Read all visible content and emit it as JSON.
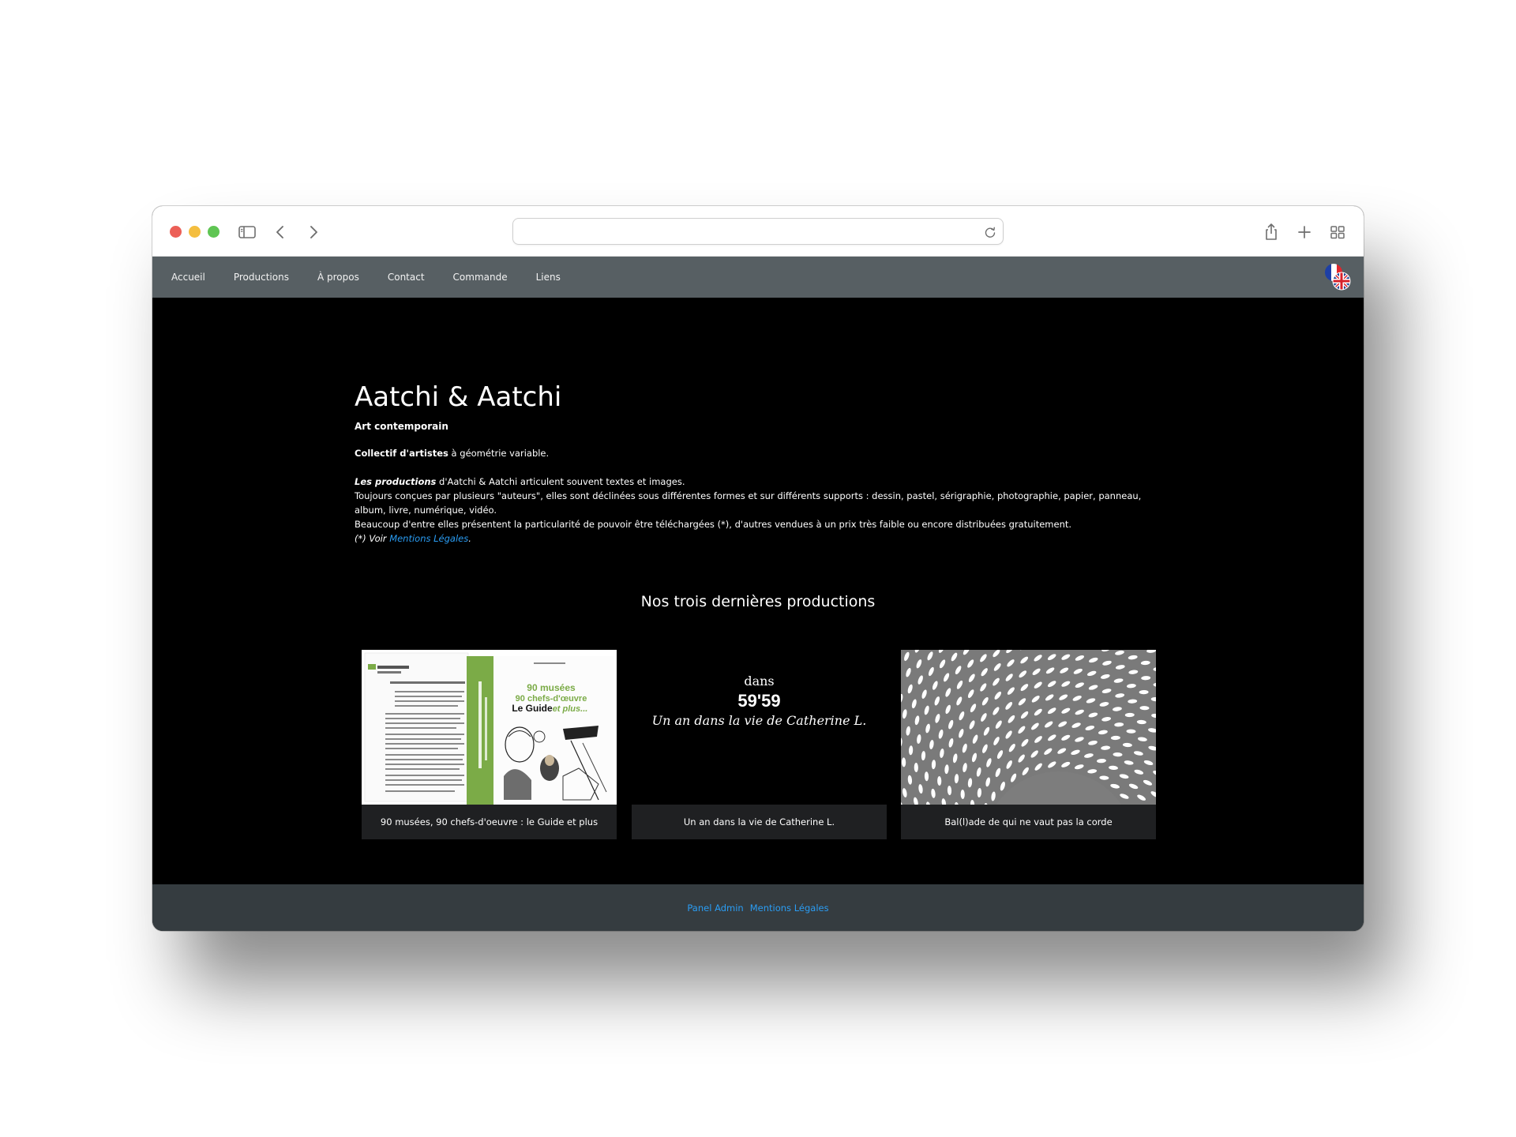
{
  "browser": {
    "url": "",
    "icons": [
      "sidebar-icon",
      "back-icon",
      "forward-icon",
      "reload-icon",
      "share-icon",
      "new-tab-icon",
      "tab-overview-icon"
    ]
  },
  "nav": {
    "items": [
      "Accueil",
      "Productions",
      "À propos",
      "Contact",
      "Commande",
      "Liens"
    ],
    "language_icon": "language-flag-icon"
  },
  "intro": {
    "title": "Aatchi & Aatchi",
    "subtitle": "Art contemporain",
    "collective_bold": "Collectif d'artistes",
    "collective_rest": " à géométrie variable.",
    "productions_italic": "Les productions",
    "productions_rest": " d'Aatchi & Aatchi articulent souvent textes et images.",
    "line2": "Toujours conçues par plusieurs \"auteurs\", elles sont déclinées sous différentes formes et sur différents supports : dessin, pastel, sérigraphie, photographie, papier, panneau, album, livre, numérique, vidéo.",
    "line3": "Beaucoup d'entre elles présentent la particularité de pouvoir être téléchargées (*), d'autres vendues à un prix très faible ou encore distribuées gratuitement.",
    "note_prefix": "(*) Voir ",
    "note_link": "Mentions Légales",
    "note_suffix": "."
  },
  "latest": {
    "heading": "Nos trois dernières productions",
    "cards": [
      {
        "caption": "90 musées, 90 chefs-d'oeuvre : le Guide et plus",
        "cover_title_1": "90 musées",
        "cover_title_2": "90 chefs-d'œuvre",
        "cover_title_3": "Le Guide",
        "cover_title_4": "et plus..."
      },
      {
        "caption": "Un an dans la vie de Catherine L.",
        "cover_line1": "dans",
        "cover_line2": "59'59",
        "cover_line3": "Un an dans la vie de Catherine L."
      },
      {
        "caption": "Bal(l)ade de qui ne vaut pas la corde"
      }
    ]
  },
  "footer": {
    "links": [
      "Panel Admin",
      "Mentions Légales"
    ]
  },
  "colors": {
    "navbar": "#575f63",
    "footer": "#353c40",
    "link": "#2a9df4",
    "cover_green": "#7bab47"
  }
}
